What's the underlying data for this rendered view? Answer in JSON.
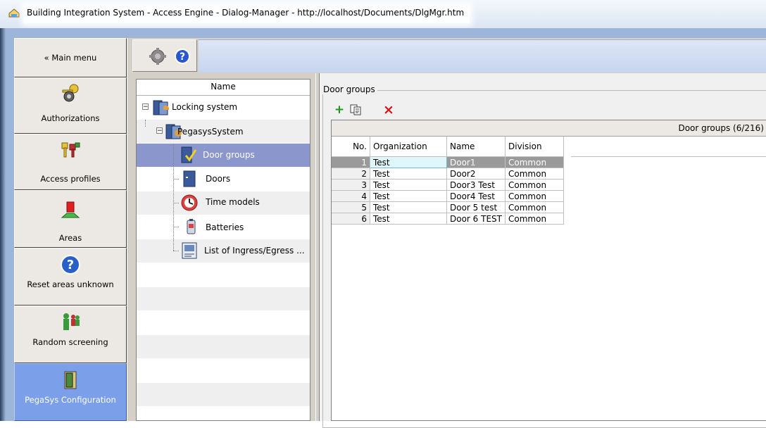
{
  "window": {
    "title": "Building Integration System - Access Engine - Dialog-Manager - http://localhost/Documents/DlgMgr.htm"
  },
  "nav": {
    "main_menu": "« Main menu",
    "items": [
      {
        "label": "Authorizations",
        "icon": "keys-icon"
      },
      {
        "label": "Access profiles",
        "icon": "key-ring-icon"
      },
      {
        "label": "Areas",
        "icon": "area-marker-icon"
      },
      {
        "label": "Reset areas unknown",
        "icon": "help-icon"
      },
      {
        "label": "Random screening",
        "icon": "people-icon"
      },
      {
        "label": "PegaSys Configuration",
        "icon": "door-icon"
      }
    ]
  },
  "toolbar": {
    "icons": [
      "gear-icon",
      "help-icon"
    ]
  },
  "tree": {
    "header": "Name",
    "nodes": [
      {
        "label": "Locking system",
        "icon": "locking-system-icon"
      },
      {
        "label": "PegasysSystem",
        "icon": "pegasys-system-icon"
      },
      {
        "label": "Door groups",
        "icon": "door-group-icon"
      },
      {
        "label": "Doors",
        "icon": "door-icon"
      },
      {
        "label": "Time models",
        "icon": "clock-icon"
      },
      {
        "label": "Batteries",
        "icon": "battery-icon"
      },
      {
        "label": "List of Ingress/Egress ...",
        "icon": "list-icon"
      }
    ]
  },
  "panel": {
    "group_title": "Door groups",
    "buttons": {
      "add": "+",
      "delete": "×"
    },
    "grid_caption": "Door groups (6/216)",
    "columns": [
      "No.",
      "Organization",
      "Name",
      "Division"
    ],
    "rows": [
      {
        "no": "1",
        "organization": "Test",
        "name": "Door1",
        "division": "Common"
      },
      {
        "no": "2",
        "organization": "Test",
        "name": "Door2",
        "division": "Common"
      },
      {
        "no": "3",
        "organization": "Test",
        "name": "Door3 Test",
        "division": "Common"
      },
      {
        "no": "4",
        "organization": "Test",
        "name": "Door4 Test",
        "division": "Common"
      },
      {
        "no": "5",
        "organization": "Test",
        "name": "Door 5 test",
        "division": "Common"
      },
      {
        "no": "6",
        "organization": "Test",
        "name": "Door 6 TEST",
        "division": "Common"
      }
    ]
  }
}
